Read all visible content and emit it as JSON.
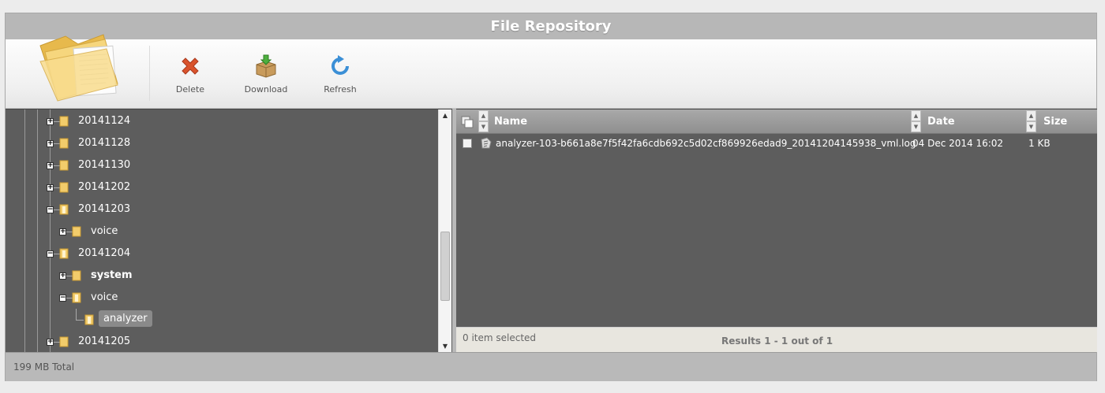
{
  "window": {
    "title": "File Repository"
  },
  "toolbar": {
    "delete_label": "Delete",
    "download_label": "Download",
    "refresh_label": "Refresh"
  },
  "tree": {
    "items": [
      {
        "label": "20141124",
        "level": 1,
        "expanded": false,
        "icon": "folder-closed-icon"
      },
      {
        "label": "20141128",
        "level": 1,
        "expanded": false,
        "icon": "folder-closed-icon"
      },
      {
        "label": "20141130",
        "level": 1,
        "expanded": false,
        "icon": "folder-closed-icon"
      },
      {
        "label": "20141202",
        "level": 1,
        "expanded": false,
        "icon": "folder-closed-icon"
      },
      {
        "label": "20141203",
        "level": 1,
        "expanded": true,
        "icon": "folder-open-icon"
      },
      {
        "label": "voice",
        "level": 2,
        "expanded": false,
        "icon": "folder-closed-icon"
      },
      {
        "label": "20141204",
        "level": 1,
        "expanded": true,
        "icon": "folder-open-icon"
      },
      {
        "label": "system",
        "level": 2,
        "expanded": false,
        "icon": "folder-closed-icon",
        "bold": true
      },
      {
        "label": "voice",
        "level": 2,
        "expanded": true,
        "icon": "folder-open-icon"
      },
      {
        "label": "analyzer",
        "level": 3,
        "selected": true,
        "icon": "folder-open-icon"
      },
      {
        "label": "20141205",
        "level": 1,
        "expanded": false,
        "icon": "folder-closed-icon"
      }
    ]
  },
  "grid": {
    "columns": {
      "name": "Name",
      "date": "Date",
      "size": "Size"
    },
    "rows": [
      {
        "name": "analyzer-103-b661a8e7f5f42fa6cdb692c5d02cf869926edad9_20141204145938_vml.log",
        "date": "04 Dec 2014 16:02",
        "size": "1 KB",
        "checked": false,
        "icon": "log-file-icon"
      }
    ],
    "selected_text": "0 item selected",
    "results_text": "Results 1 - 1 out of 1"
  },
  "status": {
    "total": "199 MB Total"
  },
  "colors": {
    "pane_bg": "#5d5d5d",
    "header_bg": "#b7b7b7",
    "delete_red": "#d9532c",
    "refresh_blue": "#3b8fd6",
    "folder_yellow": "#f2cc6b"
  }
}
